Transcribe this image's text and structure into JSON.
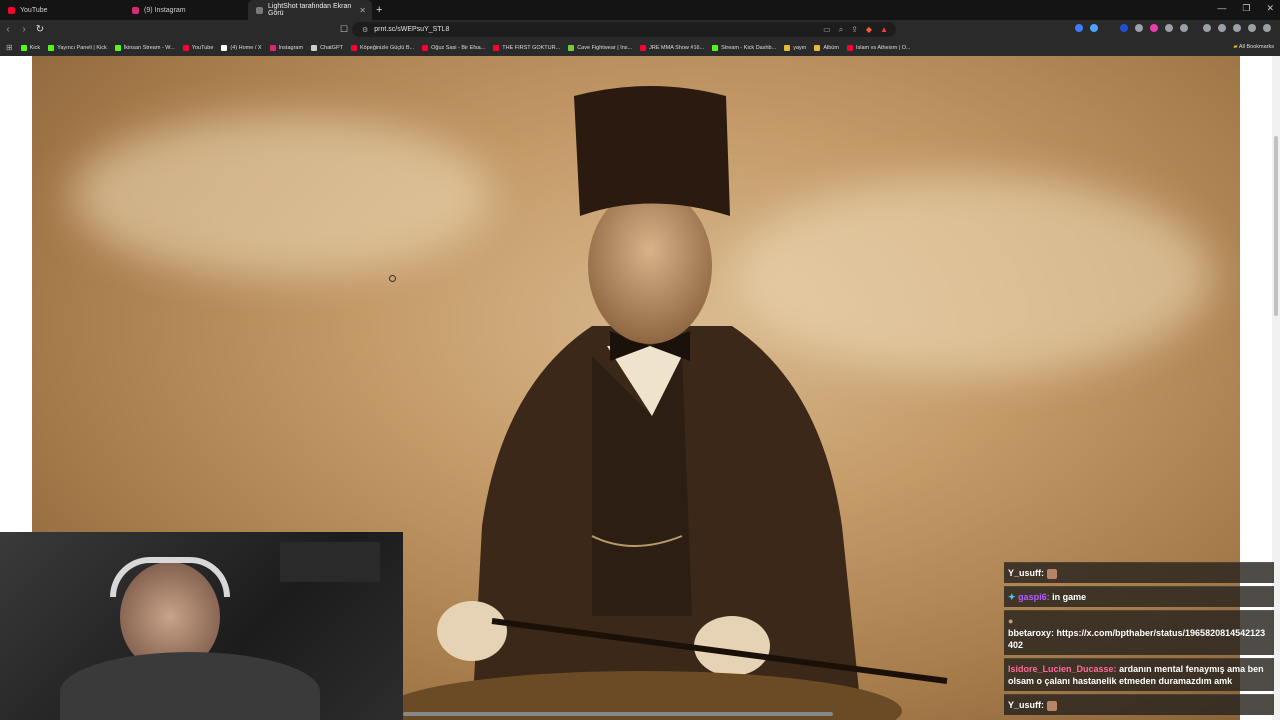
{
  "tabs": [
    {
      "label": "YouTube",
      "color": "#ff0033"
    },
    {
      "label": "(9) Instagram",
      "color": "#d62976"
    },
    {
      "label": "LightShot tarafından Ekran Görü",
      "color": "#7a7a7a"
    }
  ],
  "address": {
    "url": "prnt.sc/sWEPsuY_STL8"
  },
  "bookmarks": [
    {
      "label": "Kick",
      "color": "#53fc18"
    },
    {
      "label": "Yayıncı Paneli | Kick",
      "color": "#53fc18"
    },
    {
      "label": "İkinsan Stream - W...",
      "color": "#53fc18"
    },
    {
      "label": "YouTube",
      "color": "#ff0033"
    },
    {
      "label": "(4) Home / X",
      "color": "#ffffff"
    },
    {
      "label": "Instagram",
      "color": "#d62976"
    },
    {
      "label": "ChatGPT",
      "color": "#cccccc"
    },
    {
      "label": "Köpeğinizle Güçlü B...",
      "color": "#ff0033"
    },
    {
      "label": "Oğuz Sasi - Bir Efsa...",
      "color": "#ff0033"
    },
    {
      "label": "THE FIRST GOKTUR...",
      "color": "#ff0033"
    },
    {
      "label": "Cave Fightwear | Ins...",
      "color": "#7ac943"
    },
    {
      "label": "JRE MMA Show #16...",
      "color": "#ff0033"
    },
    {
      "label": "Stream - Kick Dashb...",
      "color": "#53fc18"
    },
    {
      "label": "yayın",
      "color": "#e8b83a"
    },
    {
      "label": "Albüm",
      "color": "#e8b83a"
    },
    {
      "label": "Islam vs Atheism | O...",
      "color": "#ff0033"
    }
  ],
  "all_bookmarks": "All Bookmarks",
  "chat": {
    "messages": [
      {
        "user": "Y_usuff:",
        "text": "",
        "style": "plain",
        "emote": true
      },
      {
        "user": "gaspi6:",
        "text": "in game",
        "style": "purple",
        "emote": false
      },
      {
        "user": "bbetaroxy:",
        "text": "https://x.com/bpthaber/status/1965820814542123402",
        "style": "plain",
        "emote": false
      },
      {
        "user": "Isidore_Lucien_Ducasse:",
        "text": "ardanın mental fenaymış ama ben olsam o çalanı hastanelik etmeden duramazdım amk",
        "style": "pink",
        "emote": false
      },
      {
        "user": "Y_usuff:",
        "text": "",
        "style": "plain",
        "emote": true
      }
    ]
  }
}
